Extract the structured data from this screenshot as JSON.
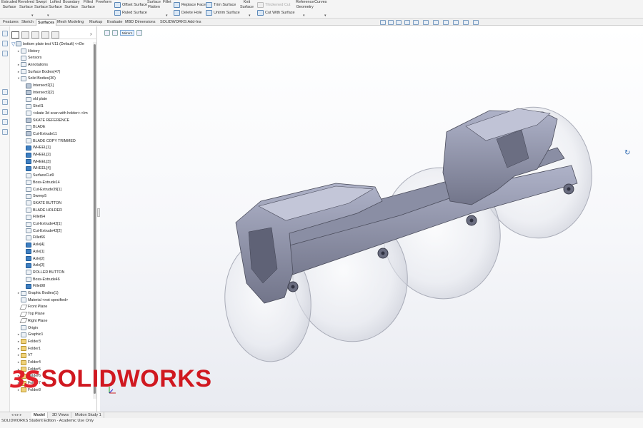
{
  "ribbon": {
    "tools_tall": [
      {
        "label": "Extruded\nSurface"
      },
      {
        "label": "Revolved\nSurface"
      },
      {
        "label": "Swept\nSurface"
      },
      {
        "label": "Lofted\nSurface"
      },
      {
        "label": "Boundary\nSurface"
      },
      {
        "label": "Filled\nSurface"
      },
      {
        "label": "Freeform"
      },
      {
        "label": "Surface\nFlatten"
      },
      {
        "label": "Fillet"
      },
      {
        "label": "Knit\nSurface"
      },
      {
        "label": "Reference\nGeometry"
      },
      {
        "label": "Curves"
      }
    ],
    "tools_small": [
      {
        "label": "Offset Surface",
        "disabled": false
      },
      {
        "label": "Ruled Surface",
        "disabled": false
      },
      {
        "label": "Replace Face",
        "disabled": false
      },
      {
        "label": "Delete Hole",
        "disabled": false
      },
      {
        "label": "Trim Surface",
        "disabled": false
      },
      {
        "label": "Untrim Surface",
        "disabled": false
      },
      {
        "label": "Thickened Cut",
        "disabled": true
      },
      {
        "label": "Cut With Surface",
        "disabled": false
      }
    ]
  },
  "tabs": [
    "Features",
    "Sketch",
    "Surfaces",
    "Mesh Modeling",
    "Markup",
    "Evaluate",
    "MBD Dimensions",
    "SOLIDWORKS Add-Ins"
  ],
  "active_tab": "Surfaces",
  "breadcrumb": {
    "label": "Mirror1"
  },
  "tree": [
    {
      "label": "bottom plate test V11 (Default) <<De",
      "level": 0,
      "icon": "part",
      "exp": ""
    },
    {
      "label": "History",
      "level": 1,
      "icon": "default",
      "exp": "▸"
    },
    {
      "label": "Sensors",
      "level": 1,
      "icon": "default",
      "exp": ""
    },
    {
      "label": "Annotations",
      "level": 1,
      "icon": "default",
      "exp": "▸"
    },
    {
      "label": "Surface Bodies(47)",
      "level": 1,
      "icon": "default",
      "exp": "▸"
    },
    {
      "label": "Solid Bodies(30)",
      "level": 1,
      "icon": "default",
      "exp": "▾"
    },
    {
      "label": "Intersect2[1]",
      "level": 2,
      "icon": "solid",
      "exp": ""
    },
    {
      "label": "Intersect2[2]",
      "level": 2,
      "icon": "solid",
      "exp": ""
    },
    {
      "label": "old plate",
      "level": 2,
      "icon": "default",
      "exp": ""
    },
    {
      "label": "Shell1",
      "level": 2,
      "icon": "default",
      "exp": ""
    },
    {
      "label": "<skate 3d scan with holder>-<Im",
      "level": 2,
      "icon": "default",
      "exp": ""
    },
    {
      "label": "SKATE REFERENCE",
      "level": 2,
      "icon": "solid",
      "exp": ""
    },
    {
      "label": "BLADE",
      "level": 2,
      "icon": "default",
      "exp": ""
    },
    {
      "label": "Cut-Extrude11",
      "level": 2,
      "icon": "solid",
      "exp": ""
    },
    {
      "label": "BLADE COPY TRIMMED",
      "level": 2,
      "icon": "default",
      "exp": ""
    },
    {
      "label": "WHEEL[1]",
      "level": 2,
      "icon": "wheel",
      "exp": ""
    },
    {
      "label": "WHEEL[2]",
      "level": 2,
      "icon": "wheel",
      "exp": ""
    },
    {
      "label": "WHEEL[3]",
      "level": 2,
      "icon": "wheel",
      "exp": ""
    },
    {
      "label": "WHEEL[4]",
      "level": 2,
      "icon": "wheel",
      "exp": ""
    },
    {
      "label": "SurfaceCut9",
      "level": 2,
      "icon": "default",
      "exp": ""
    },
    {
      "label": "Boss-Extrude14",
      "level": 2,
      "icon": "default",
      "exp": ""
    },
    {
      "label": "Cut-Extrude39[1]",
      "level": 2,
      "icon": "default",
      "exp": ""
    },
    {
      "label": "Sweep5",
      "level": 2,
      "icon": "default",
      "exp": ""
    },
    {
      "label": "SKATE BUTTON",
      "level": 2,
      "icon": "default",
      "exp": ""
    },
    {
      "label": "BLADE HOLDER",
      "level": 2,
      "icon": "default",
      "exp": ""
    },
    {
      "label": "Fillet64",
      "level": 2,
      "icon": "default",
      "exp": ""
    },
    {
      "label": "Cut-Extrude42[1]",
      "level": 2,
      "icon": "default",
      "exp": ""
    },
    {
      "label": "Cut-Extrude42[2]",
      "level": 2,
      "icon": "default",
      "exp": ""
    },
    {
      "label": "Fillet66",
      "level": 2,
      "icon": "default",
      "exp": ""
    },
    {
      "label": "Axle[4]",
      "level": 2,
      "icon": "wheel",
      "exp": ""
    },
    {
      "label": "Axle[1]",
      "level": 2,
      "icon": "wheel",
      "exp": ""
    },
    {
      "label": "Axle[2]",
      "level": 2,
      "icon": "wheel",
      "exp": ""
    },
    {
      "label": "Axle[3]",
      "level": 2,
      "icon": "wheel",
      "exp": ""
    },
    {
      "label": "ROLLER BUTTON",
      "level": 2,
      "icon": "default",
      "exp": ""
    },
    {
      "label": "Boss-Extrude46",
      "level": 2,
      "icon": "default",
      "exp": ""
    },
    {
      "label": "Fillet98",
      "level": 2,
      "icon": "wheel",
      "exp": ""
    },
    {
      "label": "Graphic Bodies(1)",
      "level": 1,
      "icon": "default",
      "exp": "▸"
    },
    {
      "label": "Material <not specified>",
      "level": 1,
      "icon": "default",
      "exp": ""
    },
    {
      "label": "Front Plane",
      "level": 1,
      "icon": "plane",
      "exp": ""
    },
    {
      "label": "Top Plane",
      "level": 1,
      "icon": "plane",
      "exp": ""
    },
    {
      "label": "Right Plane",
      "level": 1,
      "icon": "plane",
      "exp": ""
    },
    {
      "label": "Origin",
      "level": 1,
      "icon": "default",
      "exp": ""
    },
    {
      "label": "Graphic1",
      "level": 1,
      "icon": "default",
      "exp": "▸"
    },
    {
      "label": "Folder3",
      "level": 1,
      "icon": "folder",
      "exp": "▸"
    },
    {
      "label": "Folder1",
      "level": 1,
      "icon": "folder",
      "exp": "▸"
    },
    {
      "label": "V7",
      "level": 1,
      "icon": "folder",
      "exp": "▸"
    },
    {
      "label": "Folder4",
      "level": 1,
      "icon": "folder",
      "exp": "▸"
    },
    {
      "label": "Folder5",
      "level": 1,
      "icon": "folder",
      "exp": "▸"
    },
    {
      "label": "Folder6",
      "level": 1,
      "icon": "folder",
      "exp": "▸"
    },
    {
      "label": "Folder7",
      "level": 1,
      "icon": "folder",
      "exp": "▸"
    },
    {
      "label": "Folder8",
      "level": 1,
      "icon": "folder",
      "exp": "▸"
    }
  ],
  "bottom_tabs": [
    "Model",
    "3D Views",
    "Motion Study 1"
  ],
  "active_bottom_tab": "Model",
  "status": "SOLIDWORKS Student Edition - Academic Use Only",
  "logo": {
    "prefix": "SOLID",
    "suffix": "WORKS",
    "mark": "3S"
  },
  "icons": {
    "feature_manager": "feature-tree-icon",
    "property_manager": "property-icon",
    "configuration_manager": "configuration-icon",
    "dimxpert": "dimxpert-icon",
    "display_manager": "appearance-icon",
    "filter": "filter-icon",
    "rotate": "rotate-cursor-icon"
  },
  "colors": {
    "brand": "#e0202a",
    "accent": "#3f7fc1",
    "model": "#9499ae"
  }
}
